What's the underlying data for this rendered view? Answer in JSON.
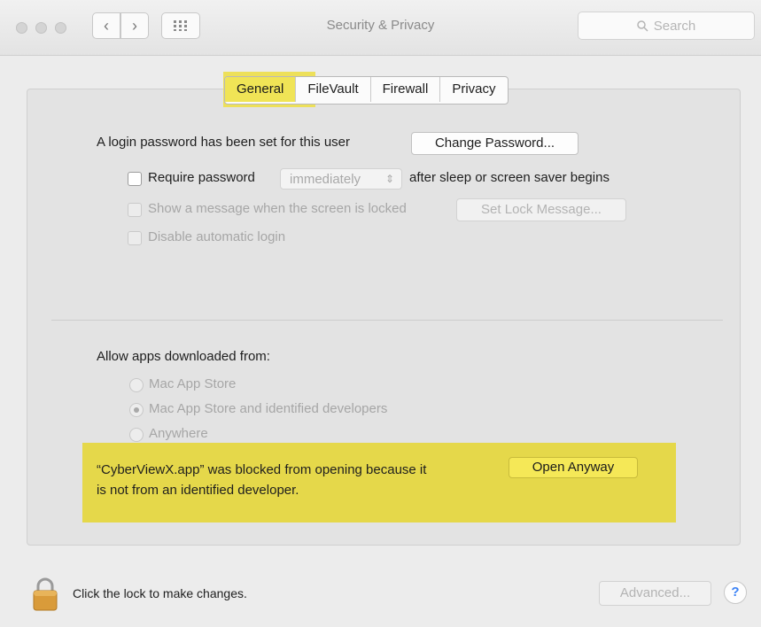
{
  "window": {
    "title": "Security & Privacy",
    "back_icon": "chevron-left-icon",
    "forward_icon": "chevron-right-icon",
    "grid_icon": "show-all-grid-icon",
    "search_placeholder": "Search",
    "search_icon": "search-icon"
  },
  "tabs": [
    {
      "label": "General",
      "active": true
    },
    {
      "label": "FileVault",
      "active": false
    },
    {
      "label": "Firewall",
      "active": false
    },
    {
      "label": "Privacy",
      "active": false
    }
  ],
  "general": {
    "login_password_text": "A login password has been set for this user",
    "change_password_label": "Change Password...",
    "require_password_label": "Require password",
    "require_password_checked": false,
    "require_password_delay": "immediately",
    "after_sleep_text": "after sleep or screen saver begins",
    "show_message_label": "Show a message when the screen is locked",
    "set_lock_message_label": "Set Lock Message...",
    "disable_auto_login_label": "Disable automatic login"
  },
  "downloads": {
    "heading": "Allow apps downloaded from:",
    "options": [
      {
        "label": "Mac App Store",
        "selected": false
      },
      {
        "label": "Mac App Store and identified developers",
        "selected": true
      },
      {
        "label": "Anywhere",
        "selected": false
      }
    ],
    "blocked_line1": "“CyberViewX.app” was blocked from opening because it",
    "blocked_line2": "is not from an identified developer.",
    "open_anyway_label": "Open Anyway"
  },
  "footer": {
    "lock_icon": "lock-icon",
    "lock_text": "Click the lock to make changes.",
    "advanced_label": "Advanced...",
    "help_label": "?"
  },
  "colors": {
    "highlight": "#ede05a",
    "panel": "#e3e3e3"
  }
}
